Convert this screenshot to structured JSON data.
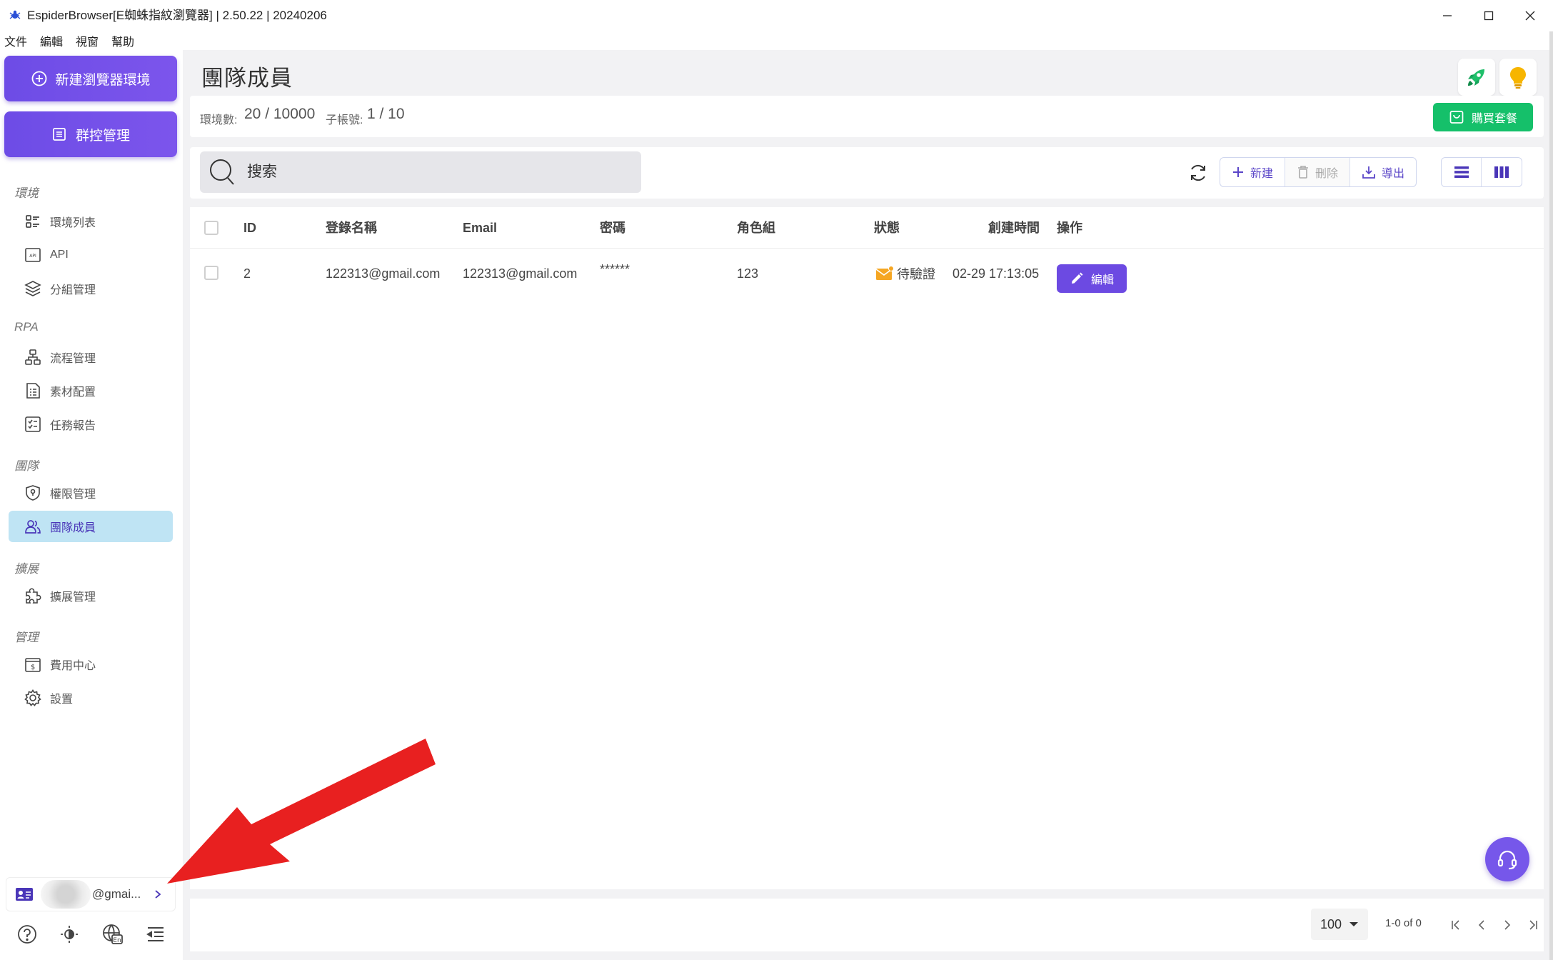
{
  "window": {
    "title": "EspiderBrowser[E蜘蛛指紋瀏覽器] | 2.50.22 | 20240206",
    "controls": [
      "minimize",
      "maximize",
      "close"
    ]
  },
  "menubar": {
    "items": [
      "文件",
      "編輯",
      "視窗",
      "幫助"
    ]
  },
  "sidebar": {
    "new_env_label": "新建瀏覽器環境",
    "group_ctrl_label": "群控管理",
    "sections": [
      {
        "label": "環境",
        "items": [
          {
            "label": "環境列表",
            "icon": "list-icon"
          },
          {
            "label": "API",
            "icon": "api-icon"
          },
          {
            "label": "分組管理",
            "icon": "layers-icon"
          }
        ]
      },
      {
        "label": "RPA",
        "items": [
          {
            "label": "流程管理",
            "icon": "flowchart-icon"
          },
          {
            "label": "素材配置",
            "icon": "document-list-icon"
          },
          {
            "label": "任務報告",
            "icon": "checklist-icon"
          }
        ]
      },
      {
        "label": "團隊",
        "items": [
          {
            "label": "權限管理",
            "icon": "shield-icon"
          },
          {
            "label": "團隊成員",
            "icon": "users-icon",
            "active": true
          }
        ]
      },
      {
        "label": "擴展",
        "items": [
          {
            "label": "擴展管理",
            "icon": "puzzle-icon"
          }
        ]
      },
      {
        "label": "管理",
        "items": [
          {
            "label": "費用中心",
            "icon": "dollar-icon"
          },
          {
            "label": "設置",
            "icon": "gear-icon"
          }
        ]
      }
    ],
    "account": {
      "email_suffix": "@gmai...",
      "chevron": "chevron-right-icon"
    },
    "bottom_icons": [
      "help-icon",
      "theme-icon",
      "language-icon",
      "collapse-menu-icon"
    ]
  },
  "header": {
    "title": "團隊成員",
    "icons": [
      "rocket-icon",
      "lightbulb-icon"
    ]
  },
  "stats": {
    "env_label": "環境數:",
    "env_value": "20 / 10000",
    "sub_label": "子帳號:",
    "sub_value": "1 / 10",
    "buy_label": "購買套餐"
  },
  "toolbar": {
    "search_placeholder": "搜索",
    "add_label": "新建",
    "delete_label": "刪除",
    "export_label": "導出"
  },
  "table": {
    "columns": [
      "ID",
      "登錄名稱",
      "Email",
      "密碼",
      "角色組",
      "狀態",
      "創建時間",
      "操作"
    ],
    "rows": [
      {
        "id": "2",
        "login": "122313@gmail.com",
        "email": "122313@gmail.com",
        "password": "******",
        "role": "123",
        "status": "待驗證",
        "created": "02-29 17:13:05",
        "action": "編輯"
      }
    ]
  },
  "pagination": {
    "per_page": "100",
    "range": "1-0 of 0"
  },
  "colors": {
    "accent": "#6c4ae2",
    "active_nav_bg": "#bfe4f4",
    "buy_green": "#15c06a",
    "status_mail": "#f5a623",
    "arrow_red": "#e82020"
  }
}
